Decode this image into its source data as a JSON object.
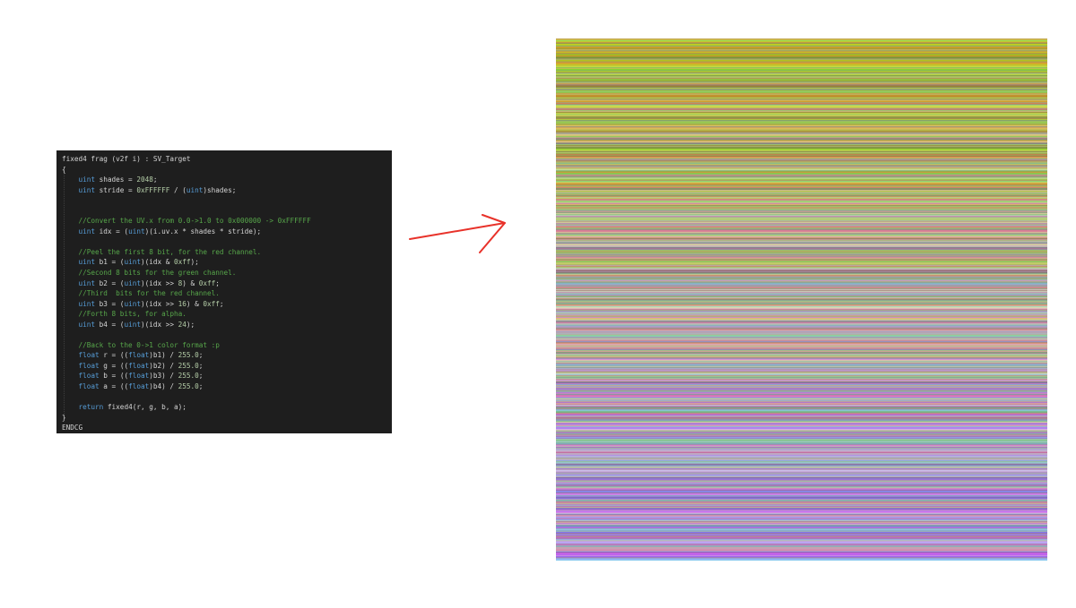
{
  "code": {
    "lines": [
      [
        {
          "t": "fixed4 frag (v2f i) : SV_Target",
          "c": "tx"
        }
      ],
      [
        {
          "t": "{",
          "c": "tx"
        }
      ],
      [
        {
          "t": "    ",
          "c": "tx"
        },
        {
          "t": "uint",
          "c": "kw"
        },
        {
          "t": " shades = ",
          "c": "tx"
        },
        {
          "t": "2048",
          "c": "nm"
        },
        {
          "t": ";",
          "c": "tx"
        }
      ],
      [
        {
          "t": "    ",
          "c": "tx"
        },
        {
          "t": "uint",
          "c": "kw"
        },
        {
          "t": " stride = ",
          "c": "tx"
        },
        {
          "t": "0xFFFFFF",
          "c": "nm"
        },
        {
          "t": " / (",
          "c": "tx"
        },
        {
          "t": "uint",
          "c": "kw"
        },
        {
          "t": ")shades;",
          "c": "tx"
        }
      ],
      [],
      [],
      [
        {
          "t": "    //Convert the UV.x from 0.0->1.0 to 0x000000 -> 0xFFFFFF",
          "c": "cm"
        }
      ],
      [
        {
          "t": "    ",
          "c": "tx"
        },
        {
          "t": "uint",
          "c": "kw"
        },
        {
          "t": " idx = (",
          "c": "tx"
        },
        {
          "t": "uint",
          "c": "kw"
        },
        {
          "t": ")(i.uv.x * shades * stride);",
          "c": "tx"
        }
      ],
      [],
      [
        {
          "t": "    //Peel the first 8 bit, for the red channel.",
          "c": "cm"
        }
      ],
      [
        {
          "t": "    ",
          "c": "tx"
        },
        {
          "t": "uint",
          "c": "kw"
        },
        {
          "t": " b1 = (",
          "c": "tx"
        },
        {
          "t": "uint",
          "c": "kw"
        },
        {
          "t": ")(idx & ",
          "c": "tx"
        },
        {
          "t": "0xff",
          "c": "nm"
        },
        {
          "t": ");",
          "c": "tx"
        }
      ],
      [
        {
          "t": "    //Second 8 bits for the green channel.",
          "c": "cm"
        }
      ],
      [
        {
          "t": "    ",
          "c": "tx"
        },
        {
          "t": "uint",
          "c": "kw"
        },
        {
          "t": " b2 = (",
          "c": "tx"
        },
        {
          "t": "uint",
          "c": "kw"
        },
        {
          "t": ")(idx >> ",
          "c": "tx"
        },
        {
          "t": "8",
          "c": "nm"
        },
        {
          "t": ") & ",
          "c": "tx"
        },
        {
          "t": "0xff",
          "c": "nm"
        },
        {
          "t": ";",
          "c": "tx"
        }
      ],
      [
        {
          "t": "    //Third  bits for the red channel.",
          "c": "cm"
        }
      ],
      [
        {
          "t": "    ",
          "c": "tx"
        },
        {
          "t": "uint",
          "c": "kw"
        },
        {
          "t": " b3 = (",
          "c": "tx"
        },
        {
          "t": "uint",
          "c": "kw"
        },
        {
          "t": ")(idx >> ",
          "c": "tx"
        },
        {
          "t": "16",
          "c": "nm"
        },
        {
          "t": ") & ",
          "c": "tx"
        },
        {
          "t": "0xff",
          "c": "nm"
        },
        {
          "t": ";",
          "c": "tx"
        }
      ],
      [
        {
          "t": "    //Forth 8 bits, for alpha.",
          "c": "cm"
        }
      ],
      [
        {
          "t": "    ",
          "c": "tx"
        },
        {
          "t": "uint",
          "c": "kw"
        },
        {
          "t": " b4 = (",
          "c": "tx"
        },
        {
          "t": "uint",
          "c": "kw"
        },
        {
          "t": ")(idx >> ",
          "c": "tx"
        },
        {
          "t": "24",
          "c": "nm"
        },
        {
          "t": ");",
          "c": "tx"
        }
      ],
      [],
      [
        {
          "t": "    //Back to the 0->1 color format :p",
          "c": "cm"
        }
      ],
      [
        {
          "t": "    ",
          "c": "tx"
        },
        {
          "t": "float",
          "c": "kw"
        },
        {
          "t": " r = ((",
          "c": "tx"
        },
        {
          "t": "float",
          "c": "kw"
        },
        {
          "t": ")b1) / ",
          "c": "tx"
        },
        {
          "t": "255.0",
          "c": "nm"
        },
        {
          "t": ";",
          "c": "tx"
        }
      ],
      [
        {
          "t": "    ",
          "c": "tx"
        },
        {
          "t": "float",
          "c": "kw"
        },
        {
          "t": " g = ((",
          "c": "tx"
        },
        {
          "t": "float",
          "c": "kw"
        },
        {
          "t": ")b2) / ",
          "c": "tx"
        },
        {
          "t": "255.0",
          "c": "nm"
        },
        {
          "t": ";",
          "c": "tx"
        }
      ],
      [
        {
          "t": "    ",
          "c": "tx"
        },
        {
          "t": "float",
          "c": "kw"
        },
        {
          "t": " b = ((",
          "c": "tx"
        },
        {
          "t": "float",
          "c": "kw"
        },
        {
          "t": ")b3) / ",
          "c": "tx"
        },
        {
          "t": "255.0",
          "c": "nm"
        },
        {
          "t": ";",
          "c": "tx"
        }
      ],
      [
        {
          "t": "    ",
          "c": "tx"
        },
        {
          "t": "float",
          "c": "kw"
        },
        {
          "t": " a = ((",
          "c": "tx"
        },
        {
          "t": "float",
          "c": "kw"
        },
        {
          "t": ")b4) / ",
          "c": "tx"
        },
        {
          "t": "255.0",
          "c": "nm"
        },
        {
          "t": ";",
          "c": "tx"
        }
      ],
      [],
      [
        {
          "t": "    ",
          "c": "tx"
        },
        {
          "t": "return",
          "c": "kw"
        },
        {
          "t": " fixed4(r, g, b, a);",
          "c": "tx"
        }
      ],
      [
        {
          "t": "}",
          "c": "tx"
        }
      ],
      [
        {
          "t": "ENDCG",
          "c": "tx"
        }
      ]
    ]
  },
  "arrow": {
    "icon": "right-arrow-icon",
    "color": "#e8322a"
  },
  "output_image": {
    "icon": "color-stripes-image",
    "top_color": "#a8b43a",
    "mid_color": "#b4a8a0",
    "bottom_color": "#a68fd2"
  },
  "colors": {
    "background": "#ffffff",
    "editor_bg": "#1e1e1e",
    "keyword": "#569cd6",
    "comment": "#57a64a",
    "number": "#b5cea8",
    "text": "#d4d4d4"
  }
}
